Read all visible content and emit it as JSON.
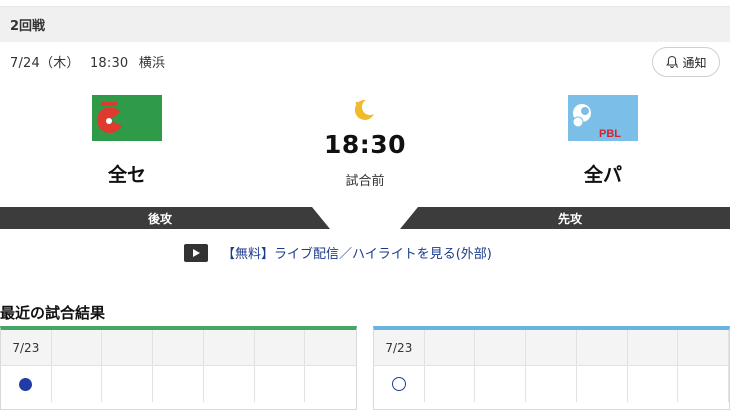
{
  "round": {
    "label": "2回戦"
  },
  "game_info": {
    "date": "7/24（木）",
    "time": "18:30",
    "venue": "横浜"
  },
  "notify": {
    "label": "通知",
    "icon": "bell-icon"
  },
  "home_team": {
    "name": "全セ",
    "logo_color": "#2f9a48",
    "bat_order": "後攻"
  },
  "away_team": {
    "name": "全パ",
    "logo_color": "#7bbfe8",
    "logo_text": "PBL",
    "bat_order": "先攻"
  },
  "center": {
    "start_time": "18:30",
    "status": "試合前",
    "icon": "moon-icon"
  },
  "live": {
    "label": "【無料】ライブ配信／ハイライトを見る(外部)",
    "icon": "play-icon"
  },
  "recent_results": {
    "title": "最近の試合結果",
    "home": {
      "date": "7/23",
      "result": "●",
      "accent": "#44a565"
    },
    "away": {
      "date": "7/23",
      "result": "○",
      "accent": "#6ab3df"
    }
  }
}
